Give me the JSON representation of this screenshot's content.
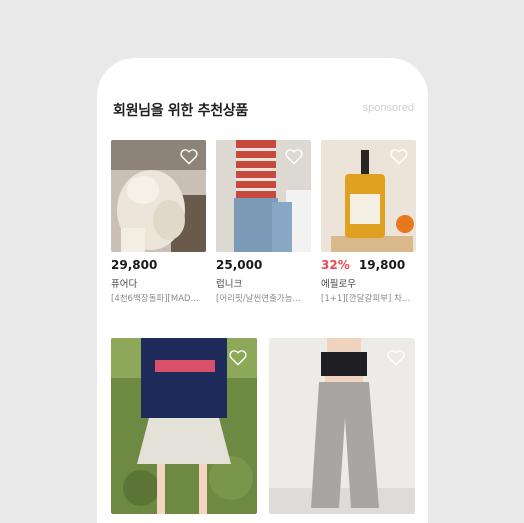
{
  "section": {
    "title": "회원님을 위한 추천상품",
    "sponsored_label": "sponsored"
  },
  "products": [
    {
      "price": "29,800",
      "brand": "퓨어다",
      "desc": "[4천6백장돌파][MAD…",
      "discount": ""
    },
    {
      "price": "25,000",
      "brand": "럽니크",
      "desc": "[어리핏/날씬연출가능…",
      "discount": ""
    },
    {
      "price": "19,800",
      "brand": "에필로우",
      "desc": "[1+1][깐달걀피부] 차…",
      "discount": "32%"
    }
  ],
  "colors": {
    "background": "#e9e9e9",
    "card": "#ffffff",
    "discount": "#f04850",
    "sponsored": "#d0d0d0"
  },
  "icons": {
    "wishlist": "heart-outline-icon"
  }
}
